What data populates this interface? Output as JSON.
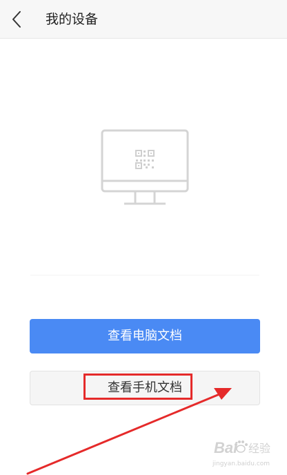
{
  "header": {
    "title": "我的设备"
  },
  "device": {
    "icon": "monitor-qr-icon"
  },
  "actions": {
    "primary_label": "查看电脑文档",
    "secondary_label": "查看手机文档"
  },
  "annotation": {
    "highlight_color": "#e52a2a"
  },
  "colors": {
    "primary": "#4a8af4",
    "header_bg": "#f7f7f7"
  },
  "watermark": {
    "brand": "Bai",
    "suffix": "经验",
    "url": "jingyan.baidu.com"
  }
}
